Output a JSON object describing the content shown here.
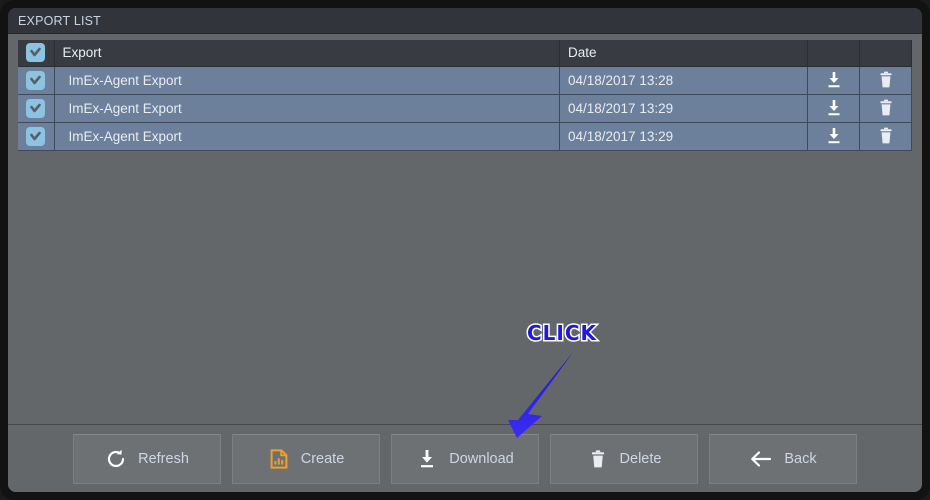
{
  "window": {
    "title": "EXPORT LIST"
  },
  "table": {
    "columns": [
      {
        "key": "check",
        "label": ""
      },
      {
        "key": "export",
        "label": "Export"
      },
      {
        "key": "date",
        "label": "Date"
      },
      {
        "key": "download",
        "label": ""
      },
      {
        "key": "delete",
        "label": ""
      }
    ],
    "header_checkbox": {
      "name": "select-all-checkbox",
      "checked": true
    },
    "rows": [
      {
        "checked": true,
        "export": "ImEx-Agent Export",
        "date": "04/18/2017 13:28"
      },
      {
        "checked": true,
        "export": "ImEx-Agent Export",
        "date": "04/18/2017 13:29"
      },
      {
        "checked": true,
        "export": "ImEx-Agent Export",
        "date": "04/18/2017 13:29"
      }
    ],
    "row_icons": {
      "download": "download-icon",
      "delete": "trash-icon"
    }
  },
  "toolbar": {
    "buttons": [
      {
        "label": "Refresh",
        "icon": "refresh-icon"
      },
      {
        "label": "Create",
        "icon": "create-document-chart-icon"
      },
      {
        "label": "Download",
        "icon": "download-icon"
      },
      {
        "label": "Delete",
        "icon": "trash-icon"
      },
      {
        "label": "Back",
        "icon": "arrow-left-icon"
      }
    ]
  },
  "annotation": {
    "text": "CLICK",
    "arrow_color": "#2417d6",
    "text_color": "#2317d8",
    "outline_color": "#ffffff",
    "points_to": "Download"
  },
  "colors": {
    "frame": "#121212",
    "panel_bg": "#63676a",
    "titlebar_bg": "#31353b",
    "title_text": "#c8d4e2",
    "table_header_bg": "#383c42",
    "row_bg": "#6c7f9b",
    "row_text": "#e8edf3",
    "checkbox_bg": "#8cc3e2",
    "button_bg": "#6d7174",
    "button_text": "#cfd6e4",
    "create_icon": "#f0a028"
  }
}
